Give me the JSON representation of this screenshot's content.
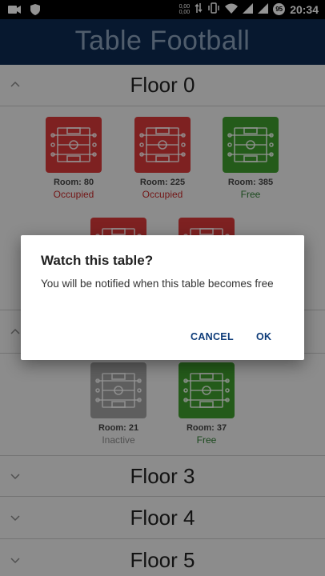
{
  "status_bar": {
    "net_up": "0,00",
    "net_down": "0,00",
    "battery_level": "95",
    "time": "20:34"
  },
  "app": {
    "title": "Table Football"
  },
  "floors": [
    {
      "title": "Floor 0"
    },
    {
      "title": "Floor 3"
    },
    {
      "title": "Floor 4"
    },
    {
      "title": "Floor 5"
    }
  ],
  "tables": [
    {
      "room": "Room: 80",
      "status": "Occupied",
      "color": "#d93a3a",
      "status_color": "#c62828"
    },
    {
      "room": "Room: 225",
      "status": "Occupied",
      "color": "#d93a3a",
      "status_color": "#c62828"
    },
    {
      "room": "Room: 385",
      "status": "Free",
      "color": "#3f9e2e",
      "status_color": "#2e7d32"
    },
    {
      "room": "Room: 21",
      "status": "Inactive",
      "color": "#a3a3a3",
      "status_color": "#8a8a8a"
    },
    {
      "room": "Room: 37",
      "status": "Free",
      "color": "#3f9e2e",
      "status_color": "#2e7d32"
    }
  ],
  "dialog": {
    "title": "Watch this table?",
    "message": "You will be notified when this table becomes free",
    "cancel_label": "CANCEL",
    "ok_label": "OK"
  }
}
